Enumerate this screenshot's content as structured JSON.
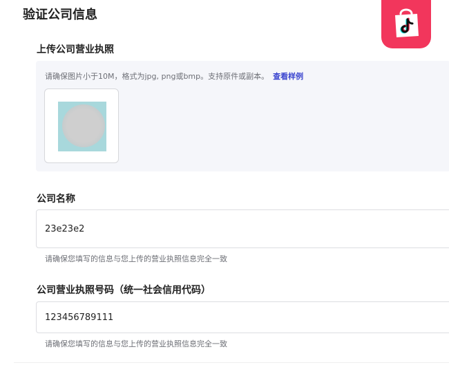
{
  "page": {
    "title": "验证公司信息"
  },
  "logo": {
    "icon": "tiktok-shop-bag-icon",
    "accent": "#f2365c"
  },
  "license_upload": {
    "label": "上传公司营业执照",
    "hint": "请确保图片小于10M，格式为jpg, png或bmp。支持原件或副本。",
    "sample_link": "查看样例",
    "thumbnail_icon": "license-image-thumbnail"
  },
  "company_name": {
    "label": "公司名称",
    "value": "23e23e2",
    "helper": "请确保您填写的信息与您上传的营业执照信息完全一致"
  },
  "license_number": {
    "label": "公司营业执照号码（统一社会信用代码）",
    "value": "123456789111",
    "helper": "请确保您填写的信息与您上传的营业执照信息完全一致"
  },
  "colors": {
    "link": "#3b45cf",
    "panel_bg": "#f5f6fa"
  }
}
